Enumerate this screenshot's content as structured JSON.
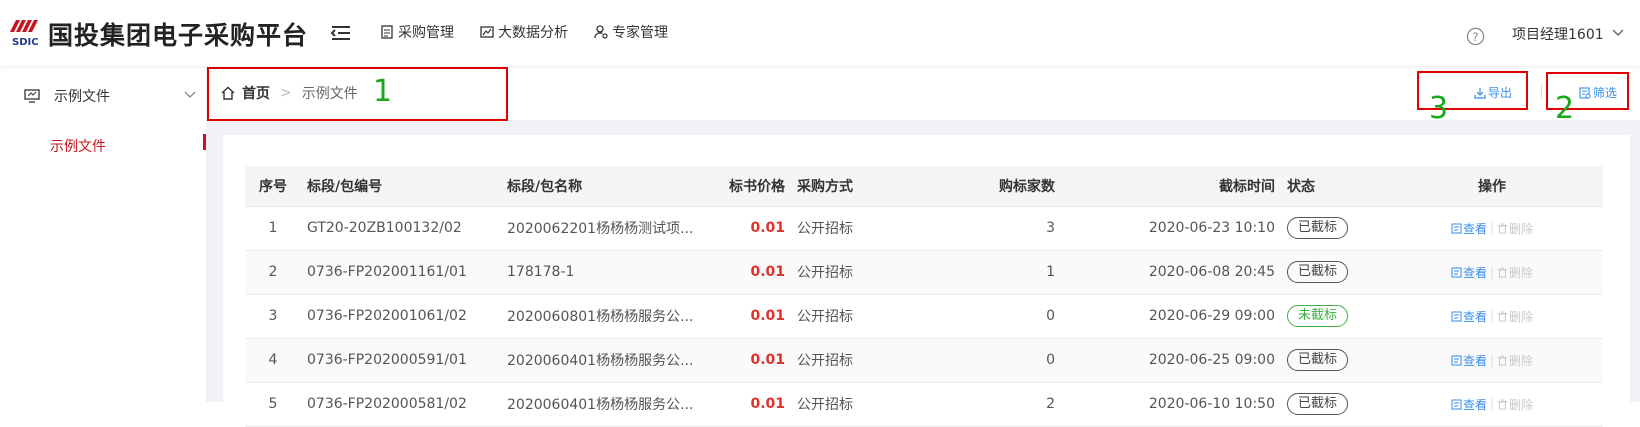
{
  "header": {
    "logo_text": "SDIC",
    "app_title": "国投集团电子采购平台",
    "nav": [
      {
        "label": "采购管理",
        "icon": "document-icon"
      },
      {
        "label": "大数据分析",
        "icon": "chart-icon"
      },
      {
        "label": "专家管理",
        "icon": "user-gear-icon"
      }
    ],
    "user_name": "项目经理1601"
  },
  "sidebar": {
    "group_label": "示例文件",
    "sub_label": "示例文件"
  },
  "breadcrumb": {
    "home": "首页",
    "current": "示例文件"
  },
  "actions": {
    "export_label": "导出",
    "filter_label": "筛选"
  },
  "annotations": [
    "1",
    "2",
    "3"
  ],
  "table": {
    "columns": [
      "序号",
      "标段/包编号",
      "标段/包名称",
      "标书价格",
      "采购方式",
      "购标家数",
      "截标时间",
      "状态",
      "操作"
    ],
    "rows": [
      {
        "no": "1",
        "code": "GT20-20ZB100132/02",
        "name": "2020062201杨杨杨测试项...",
        "price": "0.01",
        "method": "公开招标",
        "count": "3",
        "deadline": "2020-06-23 10:10",
        "status": "已截标",
        "status_color": "#555555"
      },
      {
        "no": "2",
        "code": "0736-FP202001161/01",
        "name": "178178-1",
        "price": "0.01",
        "method": "公开招标",
        "count": "1",
        "deadline": "2020-06-08 20:45",
        "status": "已截标",
        "status_color": "#555555"
      },
      {
        "no": "3",
        "code": "0736-FP202001061/02",
        "name": "2020060801杨杨杨服务公...",
        "price": "0.01",
        "method": "公开招标",
        "count": "0",
        "deadline": "2020-06-29 09:00",
        "status": "未截标",
        "status_color": "#3cb043"
      },
      {
        "no": "4",
        "code": "0736-FP202000591/01",
        "name": "2020060401杨杨杨服务公...",
        "price": "0.01",
        "method": "公开招标",
        "count": "0",
        "deadline": "2020-06-25 09:00",
        "status": "已截标",
        "status_color": "#555555"
      },
      {
        "no": "5",
        "code": "0736-FP202000581/02",
        "name": "2020060401杨杨杨服务公...",
        "price": "0.01",
        "method": "公开招标",
        "count": "2",
        "deadline": "2020-06-10 10:50",
        "status": "已截标",
        "status_color": "#555555"
      }
    ],
    "op_view": "查看",
    "op_delete": "删除"
  },
  "colors": {
    "brand": "#c8141e",
    "link": "#3a8ee6",
    "price": "#e0302b",
    "annotation_box": "#e00000",
    "annotation_number": "#18a818"
  }
}
